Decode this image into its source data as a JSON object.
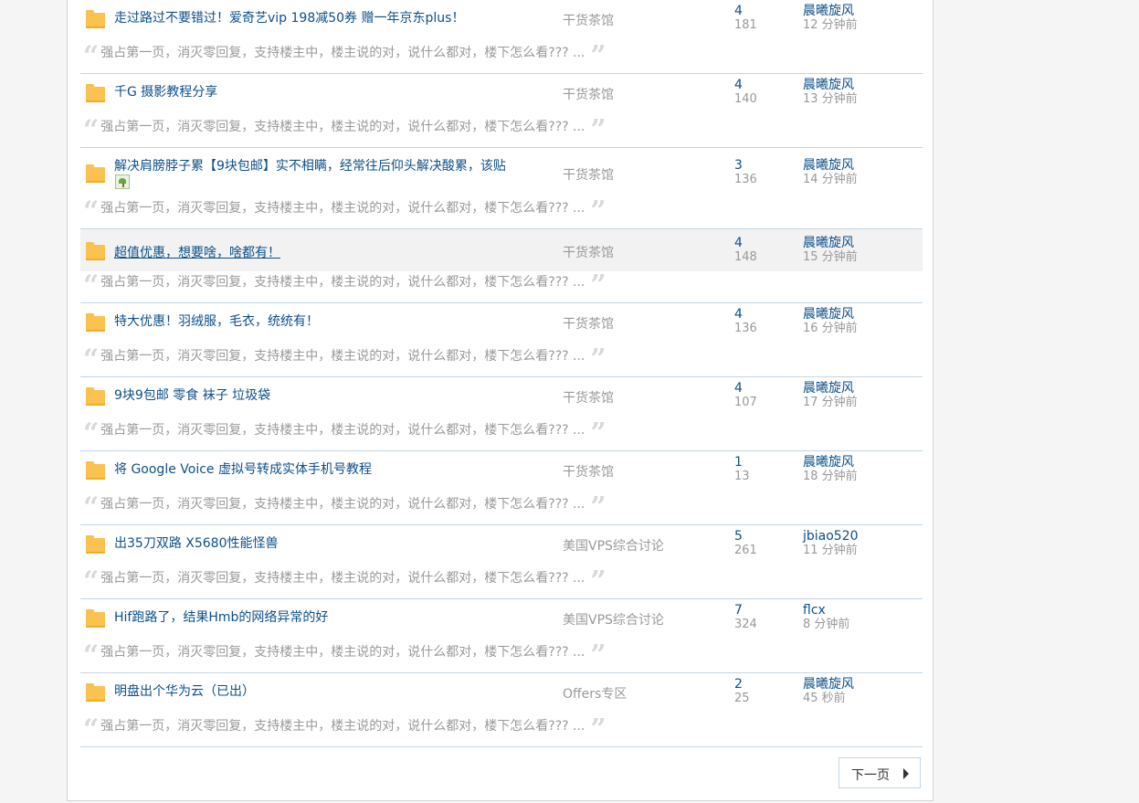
{
  "threads": [
    {
      "title": "走过路过不要错过！爱奇艺vip 198减50券 赠一年京东plus！",
      "forum": "干货茶馆",
      "replies": "4",
      "views": "181",
      "author": "晨曦旋风",
      "time": "12 分钟前",
      "excerpt": "强占第一页，消灭零回复，支持楼主中，楼主说的对，说什么都对，楼下怎么看??? ..."
    },
    {
      "title": "千G 摄影教程分享",
      "forum": "干货茶馆",
      "replies": "4",
      "views": "140",
      "author": "晨曦旋风",
      "time": "13 分钟前",
      "excerpt": "强占第一页，消灭零回复，支持楼主中，楼主说的对，说什么都对，楼下怎么看??? ..."
    },
    {
      "title": "解决肩膀脖子累【9块包邮】实不相瞒，经常往后仰头解决酸累，该贴",
      "forum": "干货茶馆",
      "replies": "3",
      "views": "136",
      "author": "晨曦旋风",
      "time": "14 分钟前",
      "excerpt": "强占第一页，消灭零回复，支持楼主中，楼主说的对，说什么都对，楼下怎么看??? ..."
    },
    {
      "title": "超值优惠，想要啥，啥都有！",
      "forum": "干货茶馆",
      "replies": "4",
      "views": "148",
      "author": "晨曦旋风",
      "time": "15 分钟前",
      "excerpt": "强占第一页，消灭零回复，支持楼主中，楼主说的对，说什么都对，楼下怎么看??? ..."
    },
    {
      "title": "特大优惠！羽绒服，毛衣，统统有！",
      "forum": "干货茶馆",
      "replies": "4",
      "views": "136",
      "author": "晨曦旋风",
      "time": "16 分钟前",
      "excerpt": "强占第一页，消灭零回复，支持楼主中，楼主说的对，说什么都对，楼下怎么看??? ..."
    },
    {
      "title": "9块9包邮 零食 袜子 垃圾袋",
      "forum": "干货茶馆",
      "replies": "4",
      "views": "107",
      "author": "晨曦旋风",
      "time": "17 分钟前",
      "excerpt": "强占第一页，消灭零回复，支持楼主中，楼主说的对，说什么都对，楼下怎么看??? ..."
    },
    {
      "title": "将 Google Voice 虚拟号转成实体手机号教程",
      "forum": "干货茶馆",
      "replies": "1",
      "views": "13",
      "author": "晨曦旋风",
      "time": "18 分钟前",
      "excerpt": "强占第一页，消灭零回复，支持楼主中，楼主说的对，说什么都对，楼下怎么看??? ..."
    },
    {
      "title": "出35刀双路 X5680性能怪兽",
      "forum": "美国VPS综合讨论",
      "replies": "5",
      "views": "261",
      "author": "jbiao520",
      "time": "11 分钟前",
      "excerpt": "强占第一页，消灭零回复，支持楼主中，楼主说的对，说什么都对，楼下怎么看??? ..."
    },
    {
      "title": "Hif跑路了，结果Hmb的网络异常的好",
      "forum": "美国VPS综合讨论",
      "replies": "7",
      "views": "324",
      "author": "flcx",
      "time": "8 分钟前",
      "excerpt": "强占第一页，消灭零回复，支持楼主中，楼主说的对，说什么都对，楼下怎么看??? ..."
    },
    {
      "title": "明盘出个华为云（已出）",
      "forum": "Offers专区",
      "replies": "2",
      "views": "25",
      "author": "晨曦旋风",
      "time": "45 秒前",
      "excerpt": "强占第一页，消灭零回复，支持楼主中，楼主说的对，说什么都对，楼下怎么看??? ..."
    }
  ],
  "pagination": {
    "next_label": "下一页"
  },
  "colors": {
    "link": "#0c4f89",
    "muted": "#999999",
    "divider": "#c2d5e3",
    "folder": "#fcc24f",
    "hover_row": "#f2f2f2"
  }
}
